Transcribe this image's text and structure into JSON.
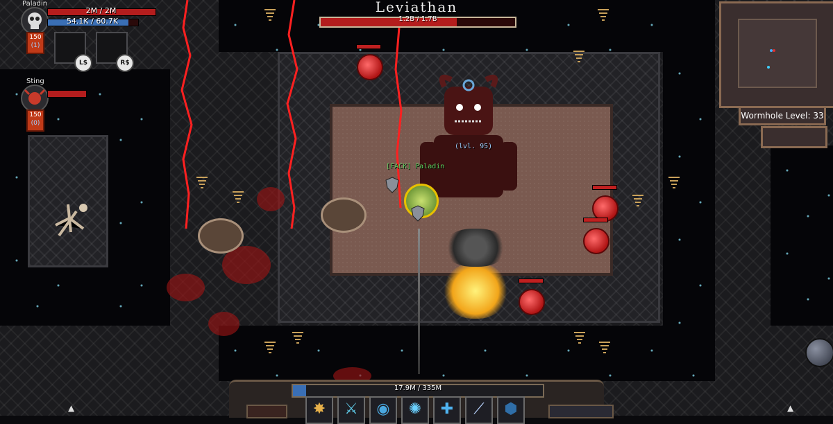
{
  "player": {
    "name": "Paladin",
    "hp_text": "2M / 2M",
    "mp_text": "54.1K / 60.7K",
    "level": "150",
    "level_sub": "(1)",
    "hp_fraction": 1.0,
    "mp_fraction": 0.89,
    "ability_keys": [
      "L$",
      "R$"
    ]
  },
  "pet": {
    "name": "Sting",
    "level": "150",
    "level_sub": "(0)"
  },
  "boss": {
    "name": "Leviathan",
    "hp_text": "1.2B / 1.7B",
    "hp_fraction": 0.7,
    "level_tag": "(lvl. 95)"
  },
  "player_tag": "[FACK] Paladin",
  "minimap": {
    "wormhole_label": "Wormhole Level: 33"
  },
  "xp": {
    "text": "17.9M / 335M",
    "fraction": 0.053
  },
  "skills": [
    {
      "icon": "paw-icon",
      "glyph": "✸",
      "color": "#e6b04a"
    },
    {
      "icon": "sword-icon",
      "glyph": "⚔",
      "color": "#5ec8e6"
    },
    {
      "icon": "orb-icon",
      "glyph": "◉",
      "color": "#4aa8e0"
    },
    {
      "icon": "starburst-icon",
      "glyph": "✺",
      "color": "#6ad0ff"
    },
    {
      "icon": "holy-cross-icon",
      "glyph": "✚",
      "color": "#4fb3f0"
    },
    {
      "icon": "blade-icon",
      "glyph": "⟋",
      "color": "#b9d4ff"
    },
    {
      "icon": "shield-icon",
      "glyph": "⬢",
      "color": "#2f6ea8"
    }
  ],
  "colors": {
    "hp": "#b41d1d",
    "mp": "#3a6fb5",
    "accent_border": "#8a6a52"
  }
}
